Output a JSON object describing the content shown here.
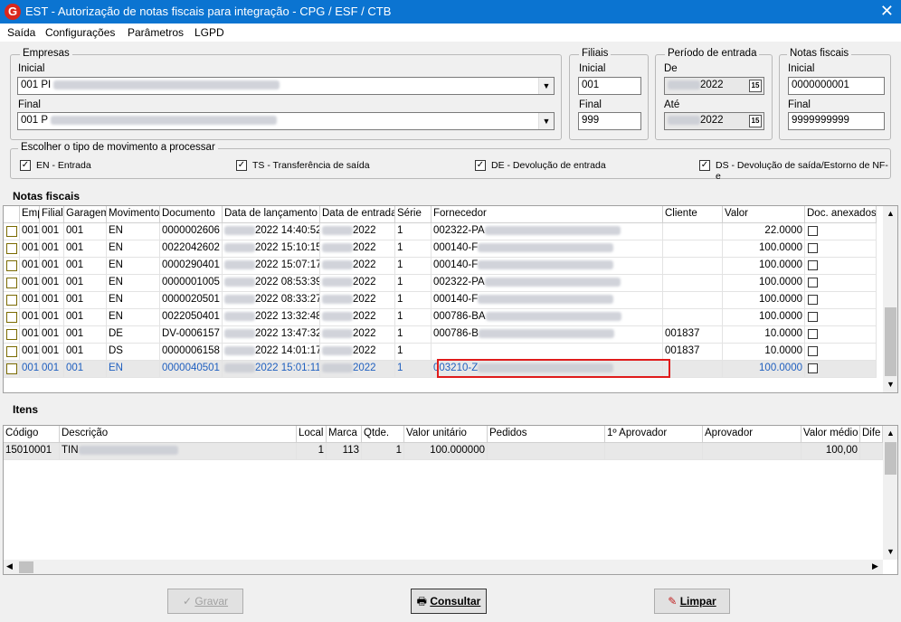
{
  "window": {
    "title": "EST - Autorização de notas fiscais para integração - CPG / ESF / CTB",
    "logo": "G",
    "close_glyph": "✕"
  },
  "menu": [
    "Saída",
    "Configurações",
    "Parâmetros",
    "LGPD"
  ],
  "empresas": {
    "legend": "Empresas",
    "inicial_label": "Inicial",
    "inicial_value": "001 PI",
    "final_label": "Final",
    "final_value": "001 P"
  },
  "filiais": {
    "legend": "Filiais",
    "inicial_label": "Inicial",
    "inicial_value": "001",
    "final_label": "Final",
    "final_value": "999"
  },
  "periodo": {
    "legend": "Período de entrada",
    "de_label": "De",
    "de_value": "2022",
    "ate_label": "Até",
    "ate_value": "2022",
    "cal_glyph": "15"
  },
  "notas": {
    "legend": "Notas fiscais",
    "inicial_label": "Inicial",
    "inicial_value": "0000000001",
    "final_label": "Final",
    "final_value": "9999999999"
  },
  "movimento": {
    "legend": "Escolher o tipo de movimento a processar",
    "options": [
      {
        "label": "EN - Entrada",
        "checked": true
      },
      {
        "label": "TS - Transferência de saída",
        "checked": true
      },
      {
        "label": "DE - Devolução de entrada",
        "checked": true
      },
      {
        "label": "DS - Devolução de saída/Estorno de NF-e",
        "checked": true
      }
    ]
  },
  "notas_grid": {
    "title": "Notas fiscais",
    "columns": [
      "Emp",
      "Filial",
      "Garagem",
      "Movimento",
      "Documento",
      "Data de lançamento",
      "Data de entrada",
      "Série",
      "Fornecedor",
      "Cliente",
      "Valor",
      "Doc. anexados"
    ],
    "rows": [
      {
        "emp": "001",
        "filial": "001",
        "garagem": "001",
        "mov": "EN",
        "doc": "0000002606",
        "lanc": "2022 14:40:52",
        "entrada": "2022",
        "serie": "1",
        "fornecedor": "002322-PA",
        "cliente": "",
        "valor": "22.0000"
      },
      {
        "emp": "001",
        "filial": "001",
        "garagem": "001",
        "mov": "EN",
        "doc": "0022042602",
        "lanc": "2022 15:10:15",
        "entrada": "2022",
        "serie": "1",
        "fornecedor": "000140-F",
        "cliente": "",
        "valor": "100.0000"
      },
      {
        "emp": "001",
        "filial": "001",
        "garagem": "001",
        "mov": "EN",
        "doc": "0000290401",
        "lanc": "2022 15:07:17",
        "entrada": "2022",
        "serie": "1",
        "fornecedor": "000140-F",
        "cliente": "",
        "valor": "100.0000"
      },
      {
        "emp": "001",
        "filial": "001",
        "garagem": "001",
        "mov": "EN",
        "doc": "0000001005",
        "lanc": "2022 08:53:39",
        "entrada": "2022",
        "serie": "1",
        "fornecedor": "002322-PA",
        "cliente": "",
        "valor": "100.0000"
      },
      {
        "emp": "001",
        "filial": "001",
        "garagem": "001",
        "mov": "EN",
        "doc": "0000020501",
        "lanc": "2022 08:33:27",
        "entrada": "2022",
        "serie": "1",
        "fornecedor": "000140-F",
        "cliente": "",
        "valor": "100.0000"
      },
      {
        "emp": "001",
        "filial": "001",
        "garagem": "001",
        "mov": "EN",
        "doc": "0022050401",
        "lanc": "2022 13:32:48",
        "entrada": "2022",
        "serie": "1",
        "fornecedor": "000786-BA",
        "cliente": "",
        "valor": "100.0000"
      },
      {
        "emp": "001",
        "filial": "001",
        "garagem": "001",
        "mov": "DE",
        "doc": "DV-0006157",
        "lanc": "2022 13:47:32",
        "entrada": "2022",
        "serie": "1",
        "fornecedor": "000786-B",
        "cliente": "001837",
        "valor": "10.0000"
      },
      {
        "emp": "001",
        "filial": "001",
        "garagem": "001",
        "mov": "DS",
        "doc": "0000006158",
        "lanc": "2022 14:01:17",
        "entrada": "2022",
        "serie": "1",
        "fornecedor": "",
        "cliente": "001837",
        "valor": "10.0000"
      },
      {
        "emp": "001",
        "filial": "001",
        "garagem": "001",
        "mov": "EN",
        "doc": "0000040501",
        "lanc": "2022 15:01:11",
        "entrada": "2022",
        "serie": "1",
        "fornecedor": "003210-Z",
        "cliente": "",
        "valor": "100.0000"
      }
    ]
  },
  "itens_grid": {
    "title": "Itens",
    "columns": [
      "Código",
      "Descrição",
      "Local",
      "Marca",
      "Qtde.",
      "Valor unitário",
      "Pedidos",
      "1º Aprovador",
      "Aprovador",
      "Valor médio",
      "Dife"
    ],
    "rows": [
      {
        "codigo": "15010001",
        "descricao": "TIN",
        "local": "1",
        "marca": "113",
        "qtde": "1",
        "valor_unit": "100.000000",
        "pedidos": "",
        "aprov1": "",
        "aprov": "",
        "valor_medio": "100,00"
      }
    ]
  },
  "buttons": {
    "gravar": "Gravar",
    "consultar": "Consultar",
    "limpar": "Limpar"
  },
  "colors": {
    "titlebar": "#0b74d1",
    "selected_text": "#1f5fbf",
    "highlight": "#e01b1b"
  }
}
